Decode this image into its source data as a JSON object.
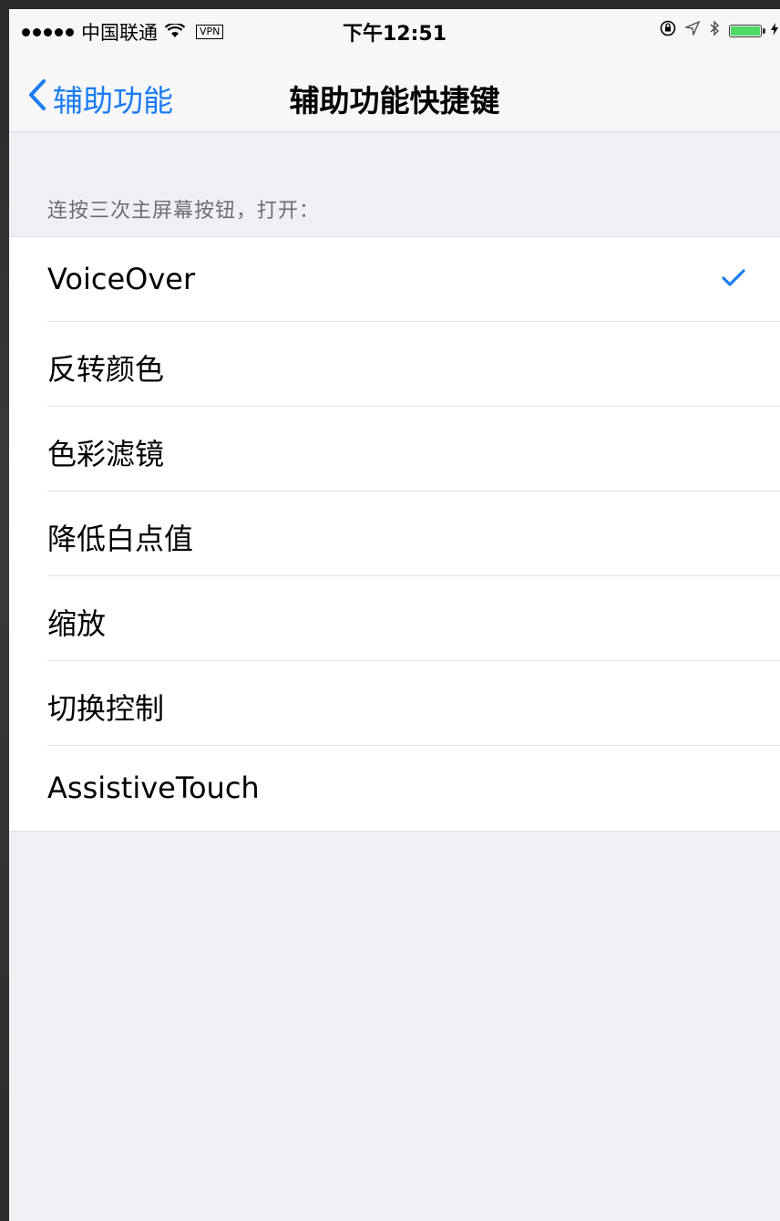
{
  "status_bar": {
    "carrier": "中国联通",
    "wifi_icon": "wifi-icon",
    "vpn": "VPN",
    "time": "下午12:51"
  },
  "nav": {
    "back_label": "辅助功能",
    "title": "辅助功能快捷键"
  },
  "section": {
    "header": "连按三次主屏幕按钮，打开：",
    "items": [
      {
        "label": "VoiceOver",
        "checked": true
      },
      {
        "label": "反转颜色",
        "checked": false
      },
      {
        "label": "色彩滤镜",
        "checked": false
      },
      {
        "label": "降低白点值",
        "checked": false
      },
      {
        "label": "缩放",
        "checked": false
      },
      {
        "label": "切换控制",
        "checked": false
      },
      {
        "label": "AssistiveTouch",
        "checked": false
      }
    ]
  },
  "colors": {
    "accent": "#1a7cf5",
    "background": "#efeff4",
    "battery": "#4cd964"
  }
}
